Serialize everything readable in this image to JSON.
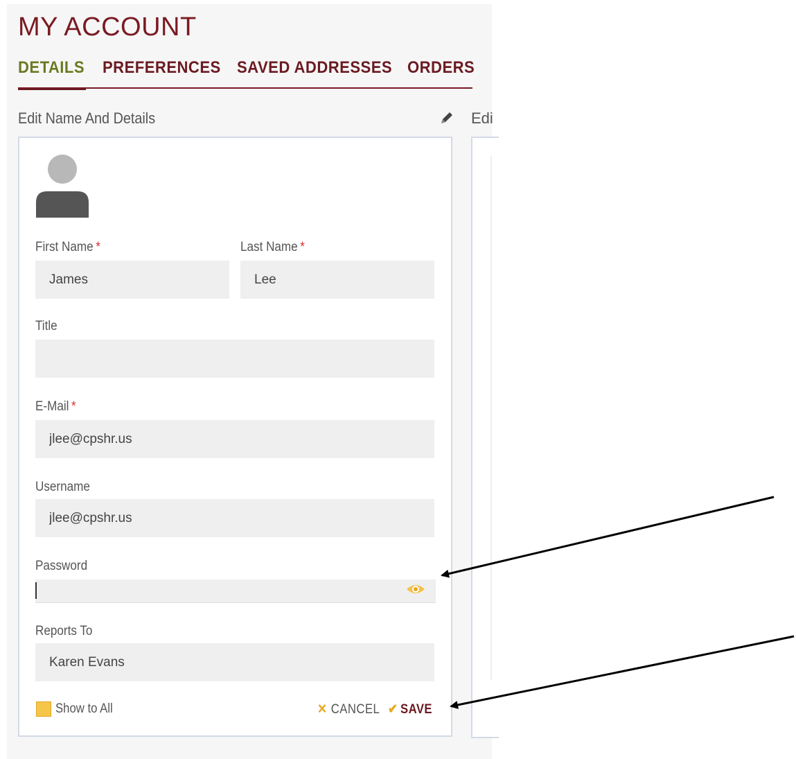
{
  "page": {
    "title": "MY ACCOUNT"
  },
  "tabs": [
    {
      "label": "DETAILS",
      "active": true
    },
    {
      "label": "PREFERENCES",
      "active": false
    },
    {
      "label": "SAVED ADDRESSES",
      "active": false
    },
    {
      "label": "ORDERS",
      "active": false
    }
  ],
  "section": {
    "title": "Edit Name And Details",
    "second_title": "Edi"
  },
  "form": {
    "first_name": {
      "label": "First Name",
      "required": "*",
      "value": "James"
    },
    "last_name": {
      "label": "Last Name",
      "required": "*",
      "value": "Lee"
    },
    "title": {
      "label": "Title",
      "value": ""
    },
    "email": {
      "label": "E-Mail",
      "required": "*",
      "value": "jlee@cpshr.us"
    },
    "username": {
      "label": "Username",
      "value": "jlee@cpshr.us"
    },
    "password": {
      "label": "Password",
      "value": ""
    },
    "reports_to": {
      "label": "Reports To",
      "value": "Karen Evans"
    },
    "show_to_all": {
      "label": "Show to All"
    },
    "cancel_label": "CANCEL",
    "save_label": "SAVE"
  },
  "icons": {
    "edit": "pencil-icon",
    "avatar": "user-avatar-icon",
    "eye": "eye-icon",
    "cancel": "x-icon",
    "save": "check-icon"
  },
  "colors": {
    "brand": "#7a1a22",
    "active_tab": "#6a7a22",
    "accent": "#f5c64a",
    "required": "#d8322e",
    "field_bg": "#efefef"
  }
}
